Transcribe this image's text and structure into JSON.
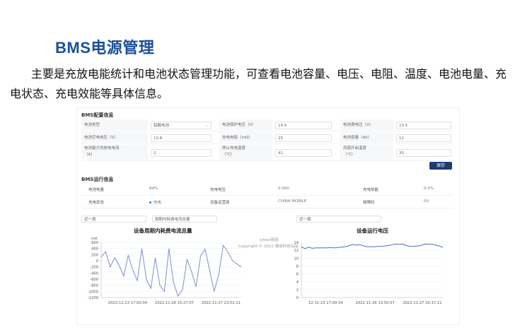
{
  "page": {
    "title": "BMS电源管理",
    "intro_line1": "主要是充放电能统计和电池状态管理功能，可查看电池容量、电压、电阻、温度、电池电量、充",
    "intro_line2": "电状态、充电效能等具体信息。"
  },
  "config": {
    "section_title": "BMS配置信息",
    "save_label": "保存",
    "rows": [
      [
        {
          "label": "电池类型",
          "value": "铅酸电池",
          "dropdown": true
        },
        {
          "label": "电池保护电压（V）",
          "value": "14.4"
        },
        {
          "label": "电池满电压（V）",
          "value": "13.5"
        }
      ],
      [
        {
          "label": "电池空电电压（V）",
          "value": "10.8"
        },
        {
          "label": "充电电阻（mΩ）",
          "value": "25"
        },
        {
          "label": "电池容量（Ah）",
          "value": "12"
        }
      ],
      [
        {
          "label": "电池最大充放电电流",
          "label2": "（A）",
          "value": "2"
        },
        {
          "label": "停止充电温度",
          "label2": "（℃）",
          "value": "41"
        },
        {
          "label": "风扇开启温度",
          "label2": "（℃）",
          "value": "35"
        }
      ]
    ]
  },
  "runtime": {
    "section_title": "BMS运行信息",
    "rows": [
      [
        {
          "label": "电池电量",
          "value": "84%"
        },
        {
          "label": "充电电压",
          "value": "0.00V"
        },
        {
          "label": "充电效能",
          "value": "0.0%"
        }
      ],
      [
        {
          "label": "充电状态",
          "value": "充电",
          "dot": true
        },
        {
          "label": "设备运营商",
          "value": "CHINA MOBILE"
        },
        {
          "label": "故障码",
          "value": "00"
        }
      ]
    ]
  },
  "filters": {
    "left_period": "近一周",
    "left_metric": "周期内耗费电流总量",
    "right_period": "近一周"
  },
  "watermark": {
    "line1": "lytest商园",
    "line2": "Copyright © 2022 泰丽科技出品"
  },
  "chart_data": [
    {
      "type": "line",
      "title": "设备周期内耗费电流总量",
      "ylabel": "mA",
      "ylim": [
        -1200,
        600
      ],
      "yticks": [
        "600",
        "400",
        "200",
        "0",
        "-200",
        "-400",
        "-600",
        "-800",
        "-1000",
        "-1200"
      ],
      "xticks": [
        "2022-11-23 17:00:34",
        "2022-11-26 15:27:07",
        "2022-11-27 23:52:11"
      ],
      "color": "#7d8fc9",
      "series": [
        {
          "values": [
            120,
            300,
            -200,
            100,
            -150,
            -500,
            180,
            -300,
            -650,
            400,
            -600,
            -900,
            100,
            -800,
            -1000,
            400,
            -700,
            -1150,
            -950,
            50,
            -350,
            -850,
            150,
            380,
            -300,
            -1000,
            -450,
            500,
            300,
            20,
            -100,
            -200
          ]
        }
      ]
    },
    {
      "type": "line",
      "title": "设备运行电压",
      "ylim": [
        0,
        14
      ],
      "yticks": [
        "14",
        "12",
        "10",
        "8",
        "6",
        "4",
        "2",
        "0"
      ],
      "xticks": [
        "12-11-23 17:00:34",
        "2022-11-26 13:50:07",
        "2022-11-27 20:37:11"
      ],
      "color": "#4a6fb5",
      "series": [
        {
          "values": [
            12.9,
            12.4,
            12.8,
            12.5,
            12.6,
            12.6,
            12.6,
            12.6,
            12.7,
            12.6,
            12.7,
            12.8,
            12.9,
            13.1,
            13.5,
            13.3,
            13.4,
            13.2,
            12.9,
            12.9,
            12.9,
            13.0,
            13.0,
            13.1,
            13.2,
            13.4,
            13.6,
            13.5,
            13.6,
            13.2,
            13.0,
            13.0,
            13.1,
            13.2,
            13.6,
            13.5,
            13.6,
            13.3,
            13.1,
            12.7
          ]
        }
      ]
    }
  ]
}
